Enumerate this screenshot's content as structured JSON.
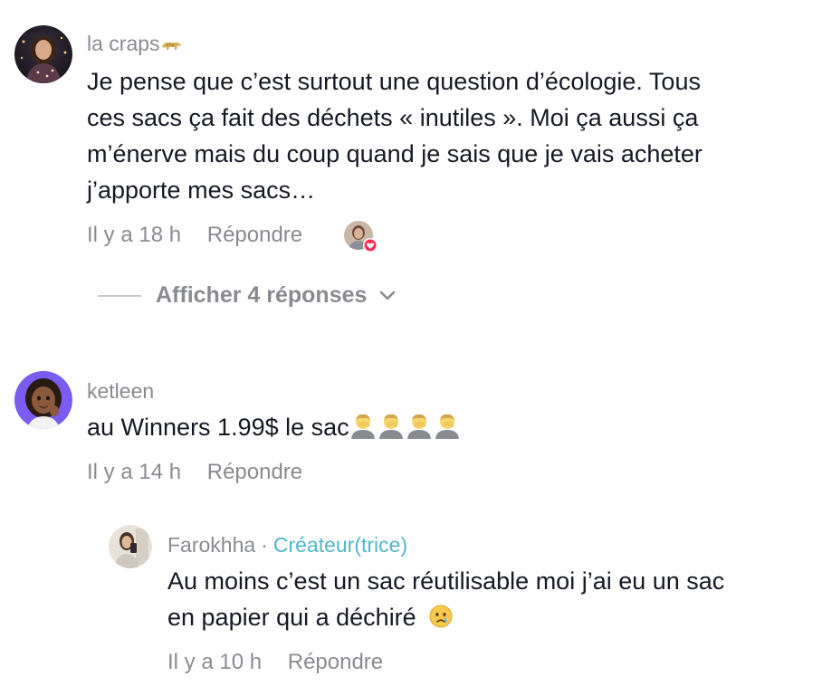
{
  "comments": [
    {
      "username": "la craps",
      "text_lines": [
        "Je pense que c’est surtout une question d’écologie. Tous",
        "ces sacs ça fait des déchets « inutiles ». Moi ça aussi ça",
        "m’énerve mais du coup quand je sais que je vais acheter",
        "j’apporte mes sacs…"
      ],
      "time": "Il y a 18 h",
      "reply_label": "Répondre",
      "avatar_icon": "avatar-woman-city-night",
      "username_emoji": "leopard-icon"
    },
    {
      "username": "ketleen",
      "text": "au Winners 1.99$ le sac",
      "time": "Il y a 14 h",
      "reply_label": "Répondre",
      "avatar_icon": "avatar-memoji-woman",
      "text_emoji": "facepalm-icon x4"
    },
    {
      "username": "Farokhha",
      "separator": "·",
      "creator_label": "Créateur(trice)",
      "text_lines": [
        "Au moins c’est un sac réutilisable moi j’ai eu un sac",
        "en papier qui a déchiré"
      ],
      "time": "Il y a 10 h",
      "reply_label": "Répondre",
      "avatar_icon": "avatar-woman-mirror-selfie",
      "text_emoji": "crying-face-icon"
    }
  ],
  "show_replies_label": "Afficher 4 réponses",
  "colors": {
    "text": "#161823",
    "muted": "#8a8b91",
    "creator": "#52b7c9",
    "heart": "#fe2c55"
  }
}
